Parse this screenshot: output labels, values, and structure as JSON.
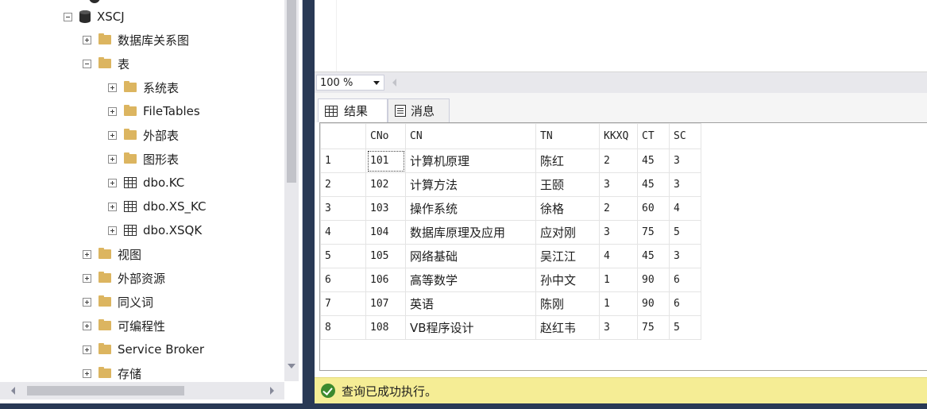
{
  "explorer": {
    "database": "XSCJ",
    "nodes": [
      {
        "label": "数据库关系图",
        "icon": "folder-icon",
        "expander": "plus"
      },
      {
        "label": "表",
        "icon": "folder-icon",
        "expander": "minus"
      },
      {
        "label": "系统表",
        "icon": "folder-icon",
        "expander": "plus"
      },
      {
        "label": "FileTables",
        "icon": "folder-icon",
        "expander": "plus"
      },
      {
        "label": "外部表",
        "icon": "folder-icon",
        "expander": "plus"
      },
      {
        "label": "图形表",
        "icon": "folder-icon",
        "expander": "plus"
      },
      {
        "label": "dbo.KC",
        "icon": "table-icon",
        "expander": "plus"
      },
      {
        "label": "dbo.XS_KC",
        "icon": "table-icon",
        "expander": "plus"
      },
      {
        "label": "dbo.XSQK",
        "icon": "table-icon",
        "expander": "plus"
      },
      {
        "label": "视图",
        "icon": "folder-icon",
        "expander": "plus"
      },
      {
        "label": "外部资源",
        "icon": "folder-icon",
        "expander": "plus"
      },
      {
        "label": "同义词",
        "icon": "folder-icon",
        "expander": "plus"
      },
      {
        "label": "可编程性",
        "icon": "folder-icon",
        "expander": "plus"
      },
      {
        "label": "Service Broker",
        "icon": "folder-icon",
        "expander": "plus"
      },
      {
        "label": "存储",
        "icon": "folder-icon",
        "expander": "plus"
      }
    ]
  },
  "zoom": {
    "value": "100 %"
  },
  "tabs": {
    "results": "结果",
    "messages": "消息"
  },
  "results": {
    "columns": [
      "",
      "CNo",
      "CN",
      "TN",
      "KKXQ",
      "CT",
      "SC"
    ],
    "rows": [
      [
        "1",
        "101",
        "计算机原理",
        "陈红",
        "2",
        "45",
        "3"
      ],
      [
        "2",
        "102",
        "计算方法",
        "王颐",
        "3",
        "45",
        "3"
      ],
      [
        "3",
        "103",
        "操作系统",
        "徐格",
        "2",
        "60",
        "4"
      ],
      [
        "4",
        "104",
        "数据库原理及应用",
        "应对刚",
        "3",
        "75",
        "5"
      ],
      [
        "5",
        "105",
        "网络基础",
        "吴江江",
        "4",
        "45",
        "3"
      ],
      [
        "6",
        "106",
        "高等数学",
        "孙中文",
        "1",
        "90",
        "6"
      ],
      [
        "7",
        "107",
        "英语",
        "陈刚",
        "1",
        "90",
        "6"
      ],
      [
        "8",
        "108",
        "VB程序设计",
        "赵红韦",
        "3",
        "75",
        "5"
      ]
    ]
  },
  "status": {
    "message": "查询已成功执行。"
  },
  "colors": {
    "status_bg": "#f5ed95",
    "chrome": "#293955",
    "success": "#3c8a2e",
    "folder": "#dcb560"
  }
}
